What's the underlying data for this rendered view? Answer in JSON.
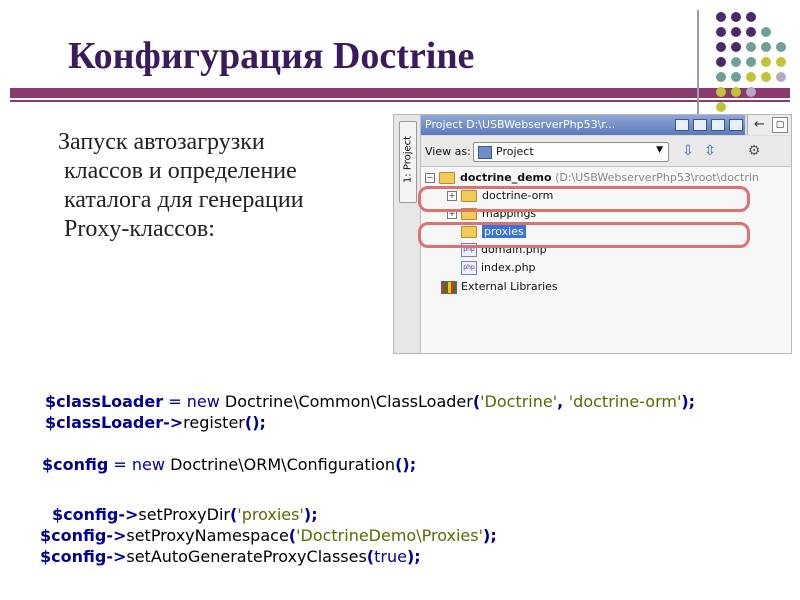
{
  "slide": {
    "title": "Конфигурация Doctrine",
    "bullet_lines": [
      "Запуск автозагрузки",
      "классов и определение",
      "каталога для генерации",
      "Proxy-классов:"
    ]
  },
  "decor": {
    "dot_colors": {
      "purple": "#4a2a6a",
      "teal": "#6f9f97",
      "olive": "#c3c337",
      "lavender": "#b9a9c9"
    },
    "accent_bar": "#8a3a6e"
  },
  "ide": {
    "side_tab": "1: Project",
    "header": "Project D:\\USBWebserverPhp53\\r...",
    "view_as_label": "View as:",
    "view_as_value": "Project",
    "tree": [
      {
        "label": "doctrine_demo",
        "path": "(D:\\USBWebserverPhp53\\root\\doctrin"
      },
      {
        "label": "doctrine-orm"
      },
      {
        "label": "mappings"
      },
      {
        "label": "proxies"
      },
      {
        "label": "domain.php"
      },
      {
        "label": "index.php"
      },
      {
        "label": "External Libraries"
      }
    ]
  },
  "code": {
    "line1": {
      "var": "$classLoader",
      "eq": "=",
      "new": "new",
      "class": "Doctrine\\Common\\ClassLoader",
      "arg1": "'Doctrine'",
      "arg2": "'doctrine-orm'"
    },
    "line2": {
      "var": "$classLoader",
      "arrow": "->",
      "method": "register",
      "parens": "()"
    },
    "line3": {
      "var": "$config",
      "eq": "=",
      "new": "new",
      "class": "Doctrine\\ORM\\Configuration",
      "parens": "()"
    },
    "line4": {
      "var": "$config",
      "arrow": "->",
      "method": "setProxyDir",
      "arg": "'proxies'"
    },
    "line5": {
      "var": "$config",
      "arrow": "->",
      "method": "setProxyNamespace",
      "arg": "'DoctrineDemo\\Proxies'"
    },
    "line6": {
      "var": "$config",
      "arrow": "->",
      "method": "setAutoGenerateProxyClasses",
      "arg": "true"
    }
  }
}
